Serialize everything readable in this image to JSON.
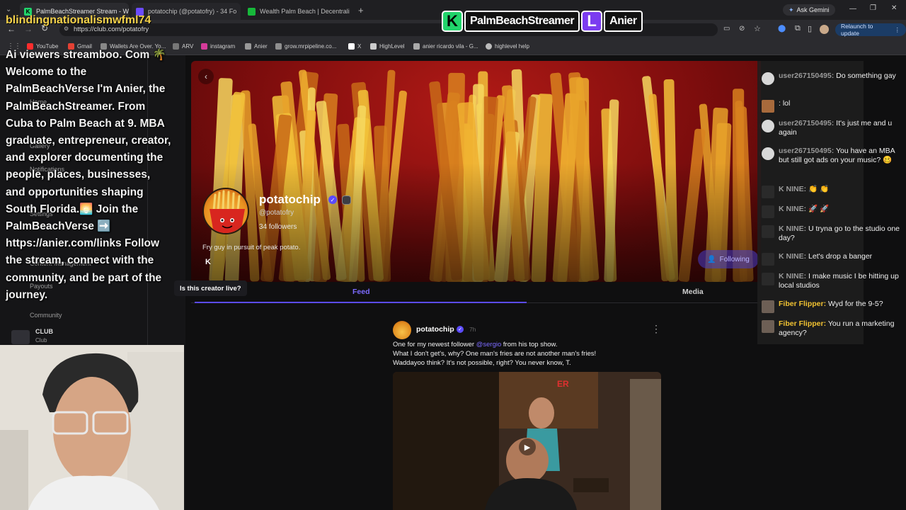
{
  "browser": {
    "tabs": [
      {
        "title": "PalmBeachStreamer Stream - W",
        "color": "#21d46b",
        "letter": "K"
      },
      {
        "title": "potatochip (@potatofry) - 34 Fo",
        "color": "#6b4bff",
        "letter": ""
      },
      {
        "title": "Wealth Palm Beach | Decentrali",
        "color": "#17b83a",
        "letter": ""
      }
    ],
    "new_tab": "+",
    "ask_gemini": "Ask Gemini",
    "url": "https://club.com/potatofry",
    "relaunch": "Relaunch to update",
    "bookmarks": [
      {
        "label": "YouTube",
        "color": "#ff2d2d"
      },
      {
        "label": "Gmail",
        "color": "#e44134"
      },
      {
        "label": "Wallets Are Over. Yo...",
        "color": "#888888"
      },
      {
        "label": "ARV",
        "color": "#777777"
      },
      {
        "label": "instagram",
        "color": "#d63b9a"
      },
      {
        "label": "Anier",
        "color": "#999999"
      },
      {
        "label": "grow.mrpipeline.co...",
        "color": "#8f8f8f"
      },
      {
        "label": "X",
        "color": "#ffffff"
      },
      {
        "label": "HighLevel",
        "color": "#cccccc"
      },
      {
        "label": "anier ricardo vila - G...",
        "color": "#aaaaaa"
      },
      {
        "label": "highlevel help",
        "color": "#bbbbbb"
      }
    ]
  },
  "stream_logo": {
    "left_text": "PalmBeachStreamer",
    "right_text": "Anier",
    "left_badge": "K",
    "right_badge": "L"
  },
  "overlay": {
    "username": "blindingnationalismwfml74",
    "message": "Ai viewers streamboo. Com 🌴 Welcome to the PalmBeachVerse I'm Anier, the PalmBeachStreamer. From Cuba to Palm Beach at 9. MBA graduate, entrepreneur, creator, and explorer documenting the people, places, businesses, and opportunities shaping South Florida.🌅 Join the PalmBeachVerse ➡️ https://anier.com/links Follow the stream, connect with the community, and be part of the journey."
  },
  "sidebar": {
    "items": [
      "Home",
      "Gallery",
      "Notifications",
      "Settings",
      "Content Management",
      "Payouts",
      "Community"
    ],
    "club_label": "CLUB",
    "club_sub": "Club"
  },
  "profile": {
    "name": "potatochip",
    "handle": "@potatofry",
    "followers": "34 followers",
    "bio": "Fry guy in pursuit of peak potato.",
    "following_label": "Following",
    "tooltip": "Is this creator live?",
    "k_label": "K"
  },
  "tabs": {
    "feed": "Feed",
    "media": "Media"
  },
  "post": {
    "author": "potatochip",
    "time": "7h",
    "line1_pre": "One for my newest follower ",
    "mention": "@sergio",
    "line1_post": " from his top show.",
    "line2": "What I don't get's, why? One man's fries are not another man's fries!",
    "line3": "Waddayoo think? It's not possible, right? You never know, T.",
    "media_sign": "ER"
  },
  "chat": [
    {
      "user": "user267150495:",
      "text": " Do something gay",
      "style": "gray",
      "avatar": "#d8d8d8",
      "sq": false
    },
    {
      "user": "",
      "text": ": lol",
      "style": "gray",
      "avatar": "#a86a3c",
      "sq": true
    },
    {
      "user": "user267150495:",
      "text": " It's just me and u again",
      "style": "gray",
      "avatar": "#d8d8d8",
      "sq": false
    },
    {
      "user": "user267150495:",
      "text": " You have an MBA but still got ads on your music? 🥴",
      "style": "gray",
      "avatar": "#d8d8d8",
      "sq": false
    },
    {
      "user": "K NINE:",
      "text": " 👏 👏",
      "style": "gray",
      "avatar": "#2a2a2a",
      "sq": true
    },
    {
      "user": "K NINE:",
      "text": " 🚀 🚀",
      "style": "gray",
      "avatar": "#2a2a2a",
      "sq": true
    },
    {
      "user": "K NINE:",
      "text": " U tryna go to the studio one day?",
      "style": "gray",
      "avatar": "#2a2a2a",
      "sq": true
    },
    {
      "user": "K NINE:",
      "text": " Let's drop a banger",
      "style": "gray",
      "avatar": "#2a2a2a",
      "sq": true
    },
    {
      "user": "K NINE:",
      "text": " I make music I be hitting up local studios",
      "style": "gray",
      "avatar": "#2a2a2a",
      "sq": true
    },
    {
      "user": "Fiber Flipper:",
      "text": " Wyd for the 9-5?",
      "style": "gold",
      "avatar": "#6d5f55",
      "sq": true
    },
    {
      "user": "Fiber Flipper:",
      "text": " You run a marketing agency?",
      "style": "gold",
      "avatar": "#6d5f55",
      "sq": true
    }
  ],
  "colors": {
    "accent": "#5b4bff",
    "gold": "#f1c232",
    "banner": "#9b1412"
  }
}
